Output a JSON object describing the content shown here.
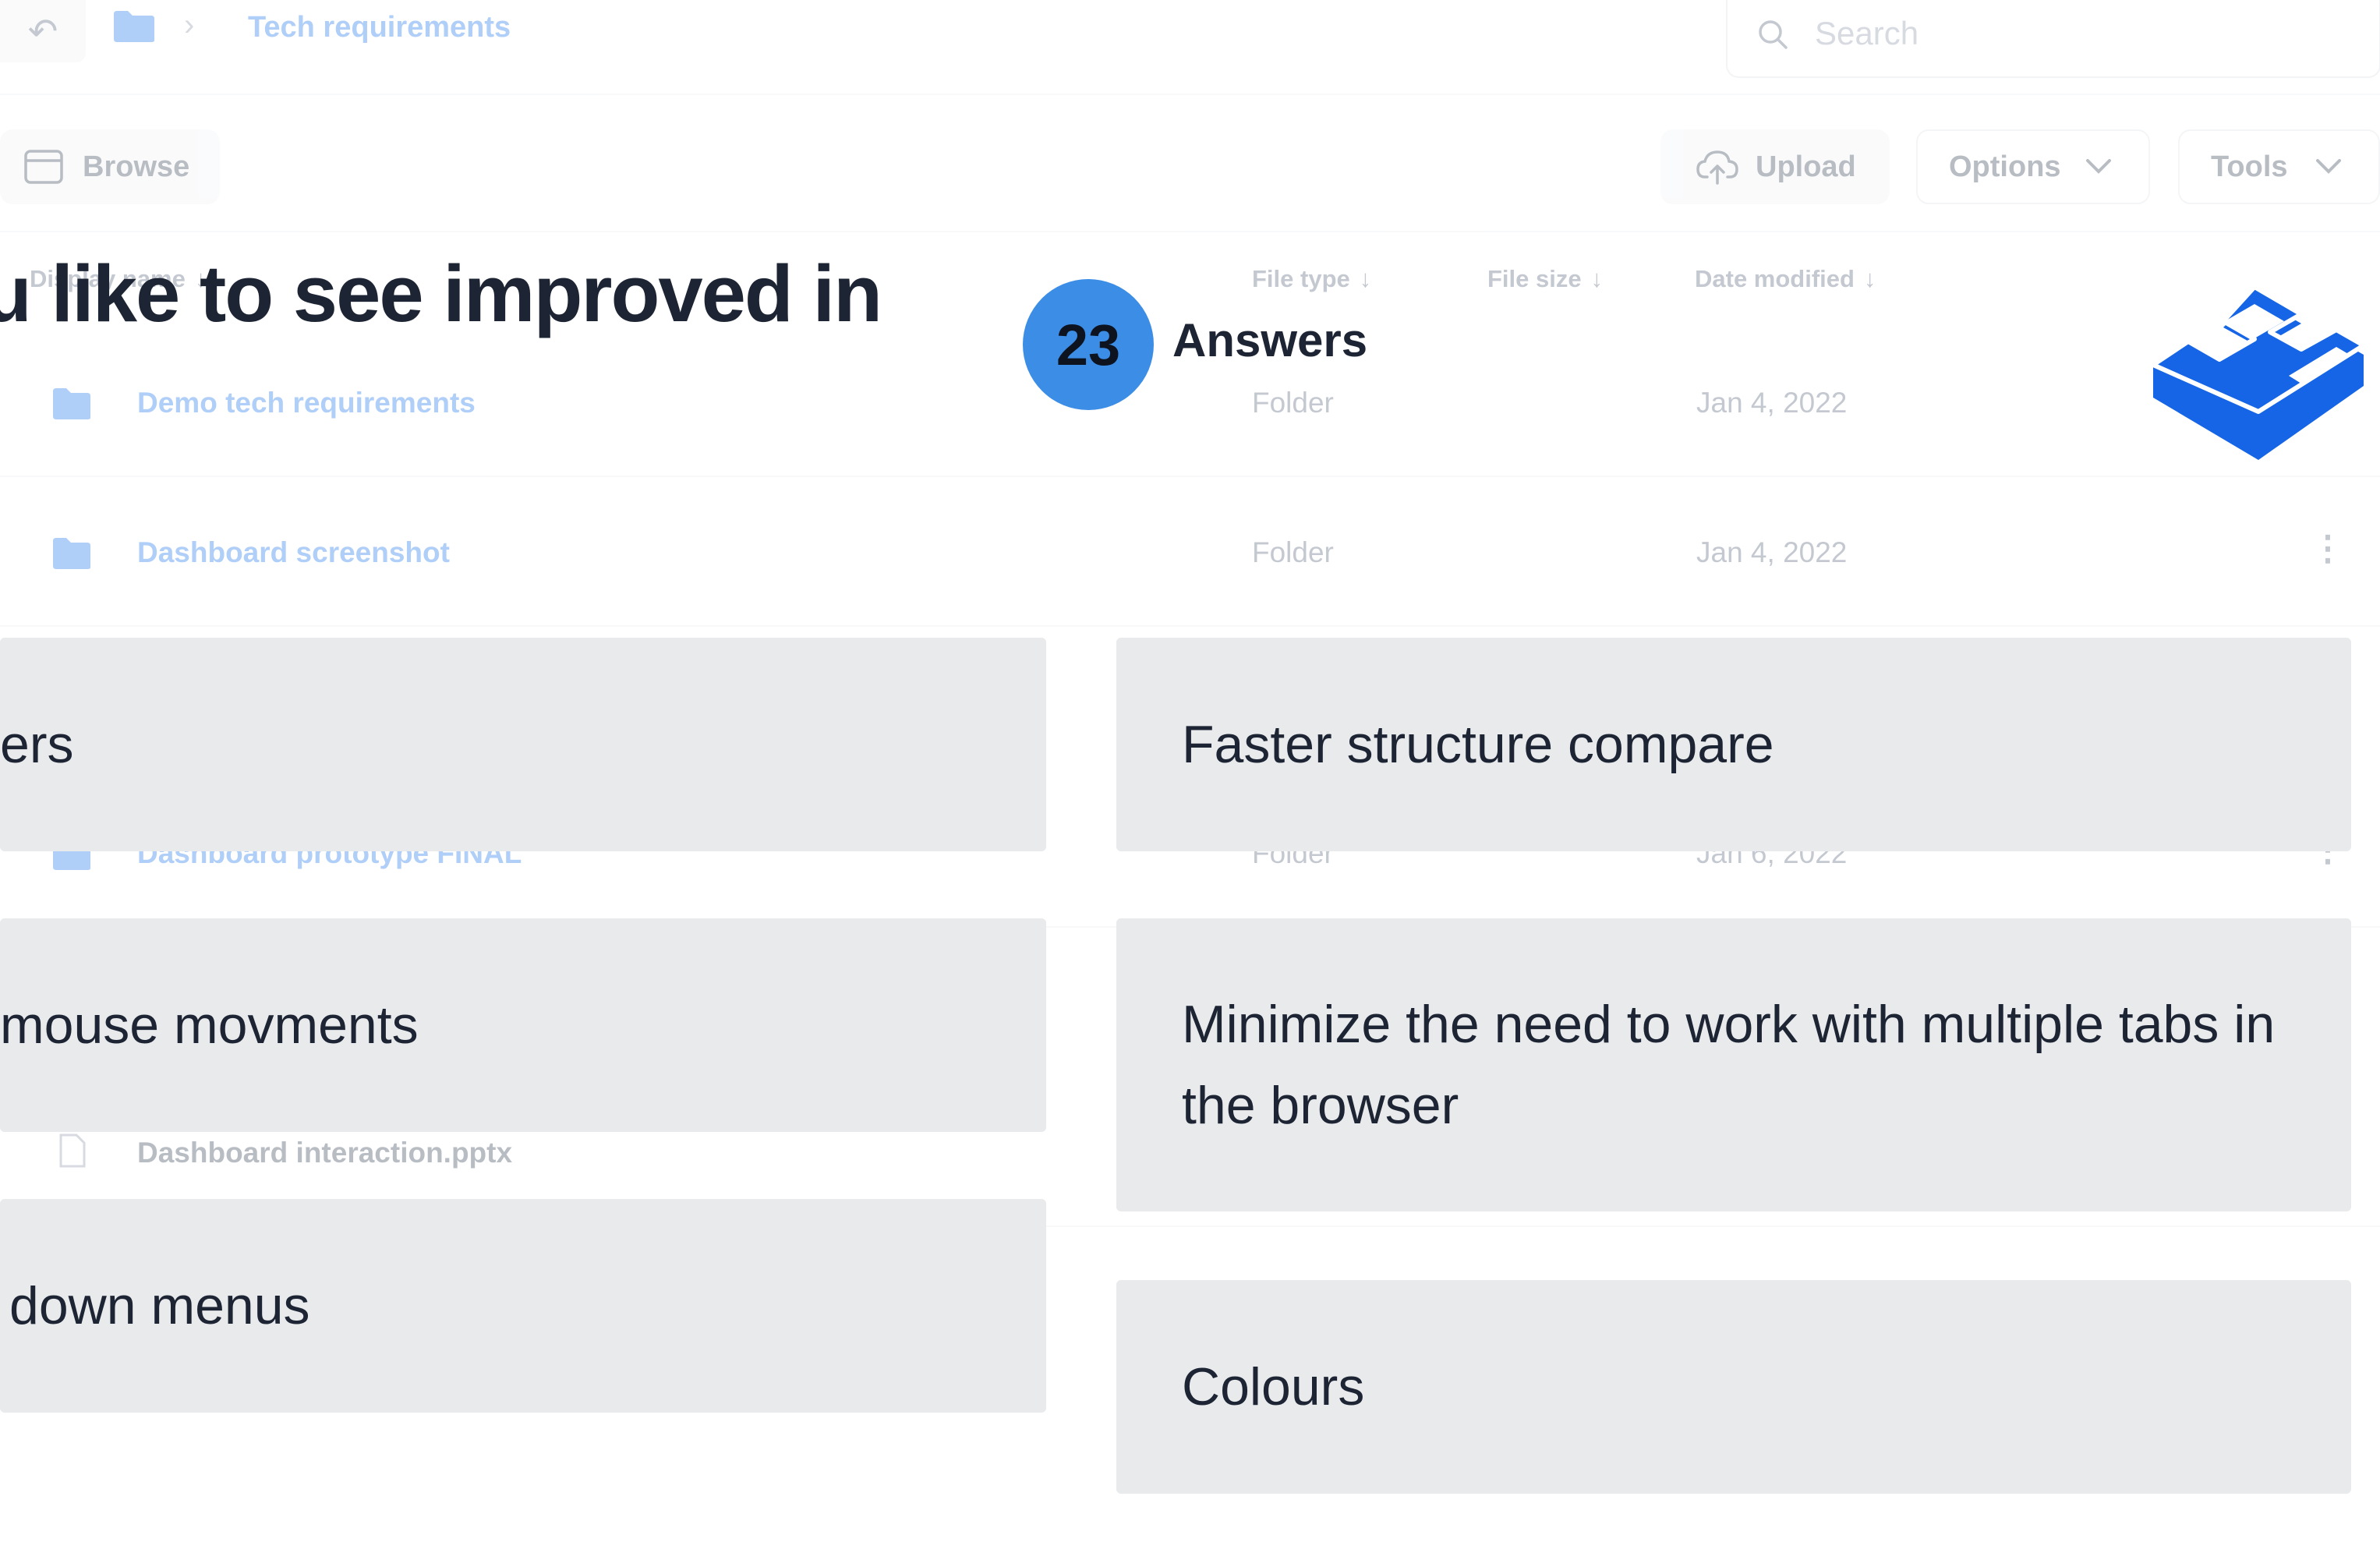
{
  "browser": {
    "breadcrumb_title": "Tech requirements",
    "search_placeholder": "Search",
    "toolbar": {
      "browse_label": "Browse",
      "upload_label": "Upload",
      "options_label": "Options",
      "tools_label": "Tools"
    },
    "columns": {
      "name": "Display name",
      "file_type": "File type",
      "file_size": "File size",
      "date_modified": "Date modified"
    },
    "rows": [
      {
        "name": "Demo tech requirements",
        "type": "Folder",
        "date": "Jan 4, 2022",
        "icon": "folder-icon"
      },
      {
        "name": "Dashboard screenshot",
        "type": "Folder",
        "date": "Jan 4, 2022",
        "icon": "folder-icon"
      },
      {
        "name": "Dashboard prototype FINAL",
        "type": "Folder",
        "date": "Jan 6, 2022",
        "icon": "folder-icon"
      },
      {
        "name": "Dashboard interaction.pptx",
        "type": "",
        "date": "",
        "icon": "file-icon"
      }
    ],
    "colors": {
      "accent": "#2f80ed",
      "muted": "#667085"
    }
  },
  "poll": {
    "question": "u like to see improved in",
    "answer_count": "23",
    "answer_label": "Answers",
    "brand_color": "#1565e6",
    "badge_color": "#3b8de6",
    "answers_left": [
      "ers",
      "mouse movments",
      "down menus"
    ],
    "answers_right": [
      "Faster structure compare",
      "Minimize the need to work with multiple tabs in the browser",
      "Colours"
    ]
  }
}
